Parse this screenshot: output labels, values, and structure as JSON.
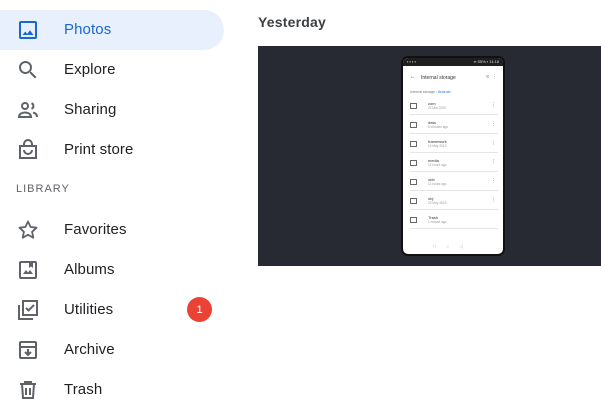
{
  "sidebar": {
    "items": [
      {
        "label": "Photos",
        "icon": "photo-icon",
        "active": true
      },
      {
        "label": "Explore",
        "icon": "search-icon"
      },
      {
        "label": "Sharing",
        "icon": "people-icon"
      },
      {
        "label": "Print store",
        "icon": "shopping-bag-icon"
      }
    ],
    "library_label": "LIBRARY",
    "library_items": [
      {
        "label": "Favorites",
        "icon": "star-icon"
      },
      {
        "label": "Albums",
        "icon": "album-icon"
      },
      {
        "label": "Utilities",
        "icon": "checklist-icon",
        "badge": "1"
      },
      {
        "label": "Archive",
        "icon": "archive-icon"
      },
      {
        "label": "Trash",
        "icon": "trash-icon"
      }
    ]
  },
  "main": {
    "date_heading": "Yesterday",
    "photo": {
      "status_left": "▪ ▪ ▪ ▪",
      "status_right": "▪▪ 55% ▪ 11:18",
      "title": "Internal storage",
      "breadcrumb_root": "Internal storage",
      "breadcrumb_sep": "›",
      "breadcrumb_current": "Android",
      "files": [
        {
          "name": "com",
          "sub": "24 Mar 2020"
        },
        {
          "name": "data",
          "sub": "5 minutes ago"
        },
        {
          "name": "framework",
          "sub": "14 May 2019"
        },
        {
          "name": "media",
          "sub": "11 hours ago"
        },
        {
          "name": "obb",
          "sub": "11 hours ago"
        },
        {
          "name": "obj",
          "sub": "22 May 2019"
        },
        {
          "name": "Trash",
          "sub": "1 minute ago"
        }
      ]
    }
  },
  "colors": {
    "active_bg": "#e8f0fe",
    "active_fg": "#1967d2",
    "badge": "#ea4335",
    "photo_bg": "#272a33"
  }
}
